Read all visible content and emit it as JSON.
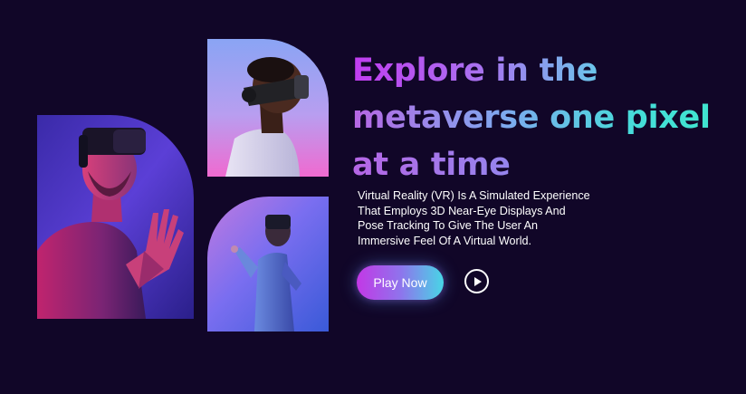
{
  "hero": {
    "headline_lines": [
      "Explore in the",
      "metaverse one pixel",
      "at a time"
    ],
    "description_lines": [
      "Virtual Reality (VR) Is A Simulated Experience",
      "That Employs 3D Near-Eye Displays And",
      "Pose Tracking To Give The User An",
      "Immersive Feel Of A Virtual World."
    ],
    "play_button_label": "Play Now",
    "play_icon": "play-icon"
  },
  "images": {
    "left": "vr-man-hand-raised",
    "top": "vr-man-profile",
    "bottom": "vr-man-reaching"
  },
  "colors": {
    "background": "#110628",
    "accent_pink": "#c338e6",
    "accent_cyan": "#48d6e6",
    "text": "#ffffff"
  }
}
